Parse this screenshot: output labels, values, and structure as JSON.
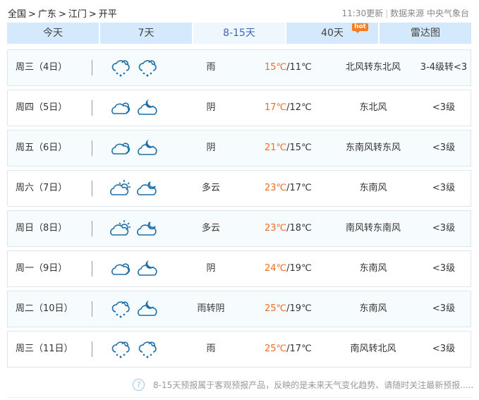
{
  "breadcrumb": [
    "全国",
    ">",
    "广东",
    ">",
    "江门",
    ">",
    "开平"
  ],
  "source": {
    "update": "11:30更新",
    "label": "数据来源 中央气象台"
  },
  "tabs": [
    {
      "label": "今天"
    },
    {
      "label": "7天"
    },
    {
      "label": "8-15天",
      "active": true
    },
    {
      "label": "40天",
      "badge": "hot"
    },
    {
      "label": "雷达图"
    }
  ],
  "days": [
    {
      "date": "周三（4日）",
      "icons": [
        "rain",
        "rain"
      ],
      "desc": "雨",
      "high": "15℃",
      "low": "/11℃",
      "wind": "北风转东北风",
      "level": "3-4级转<3"
    },
    {
      "date": "周四（5日）",
      "icons": [
        "overcast",
        "cloudy-night"
      ],
      "desc": "阴",
      "high": "17℃",
      "low": "/12℃",
      "wind": "东北风",
      "level": "<3级"
    },
    {
      "date": "周五（6日）",
      "icons": [
        "overcast",
        "cloudy-night"
      ],
      "desc": "阴",
      "high": "21℃",
      "low": "/15℃",
      "wind": "东南风转东风",
      "level": "<3级"
    },
    {
      "date": "周六（7日）",
      "icons": [
        "partly-cloudy-day",
        "partly-cloudy-night"
      ],
      "desc": "多云",
      "high": "23℃",
      "low": "/17℃",
      "wind": "东南风",
      "level": "<3级"
    },
    {
      "date": "周日（8日）",
      "icons": [
        "partly-cloudy-day",
        "partly-cloudy-night"
      ],
      "desc": "多云",
      "high": "23℃",
      "low": "/18℃",
      "wind": "南风转东南风",
      "level": "<3级"
    },
    {
      "date": "周一（9日）",
      "icons": [
        "overcast",
        "cloudy-night"
      ],
      "desc": "阴",
      "high": "24℃",
      "low": "/19℃",
      "wind": "东南风",
      "level": "<3级"
    },
    {
      "date": "周二（10日）",
      "icons": [
        "rain",
        "cloudy-night"
      ],
      "desc": "雨转阴",
      "high": "25℃",
      "low": "/19℃",
      "wind": "东南风",
      "level": "<3级"
    },
    {
      "date": "周三（11日）",
      "icons": [
        "rain",
        "rain"
      ],
      "desc": "雨",
      "high": "25℃",
      "low": "/17℃",
      "wind": "南风转北风",
      "level": "<3级"
    }
  ],
  "footer": {
    "icon": "?",
    "text": "8-15天预报属于客观预报产品，反映的是未来天气变化趋势、请随时关注最新预报....."
  },
  "colors": {
    "accent": "#f56b1f",
    "tab": "#d4e9fb",
    "icon": "#1f6fa8"
  }
}
